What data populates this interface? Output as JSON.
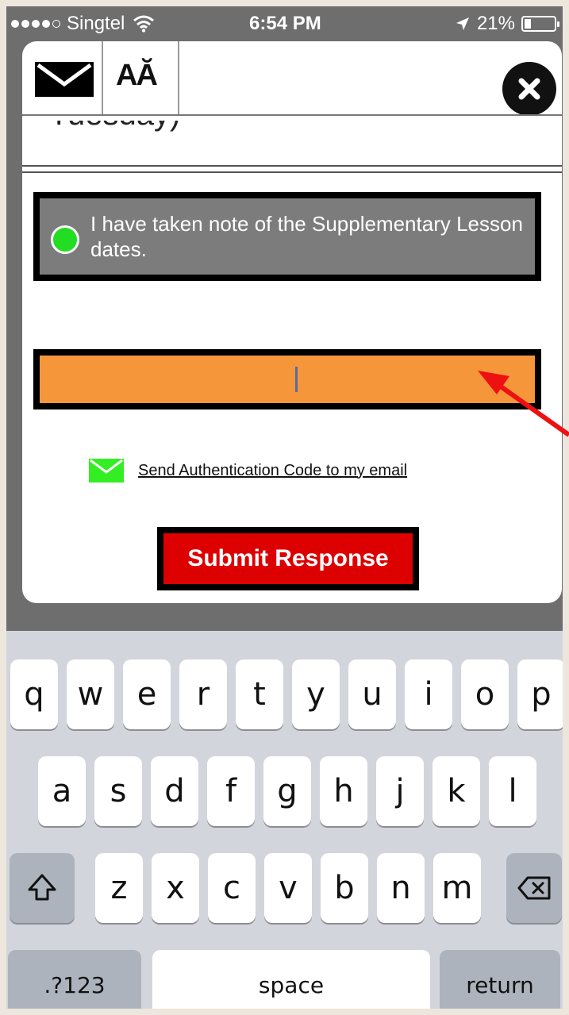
{
  "status_bar": {
    "carrier": "Singtel",
    "time": "6:54 PM",
    "battery": "21%",
    "battery_level": 0.21
  },
  "toolbar": {
    "font_button_label": "AĂ"
  },
  "form": {
    "partial_text": "Tuesday)",
    "consent_text": "I have taken note of the Supplementary Lesson dates.",
    "consent_selected": true,
    "code_input_value": "",
    "send_code_link": "Send Authentication Code to my email",
    "submit_label": "Submit Response"
  },
  "keyboard": {
    "row1": [
      "q",
      "w",
      "e",
      "r",
      "t",
      "y",
      "u",
      "i",
      "o",
      "p"
    ],
    "row2": [
      "a",
      "s",
      "d",
      "f",
      "g",
      "h",
      "j",
      "k",
      "l"
    ],
    "row3": [
      "z",
      "x",
      "c",
      "v",
      "b",
      "n",
      "m"
    ],
    "numbers_key": ".?123",
    "space_key": "space",
    "return_key": "return"
  },
  "colors": {
    "consent_bg": "#7c7c7c",
    "radio": "#22dd22",
    "input_bg": "#f6963a",
    "submit_bg": "#dd0000",
    "arrow": "#ee1111"
  },
  "icons": {
    "mail_button": "envelope-icon",
    "close_button": "close-icon",
    "send_link": "envelope-icon",
    "shift": "shift-icon",
    "delete": "backspace-icon"
  }
}
